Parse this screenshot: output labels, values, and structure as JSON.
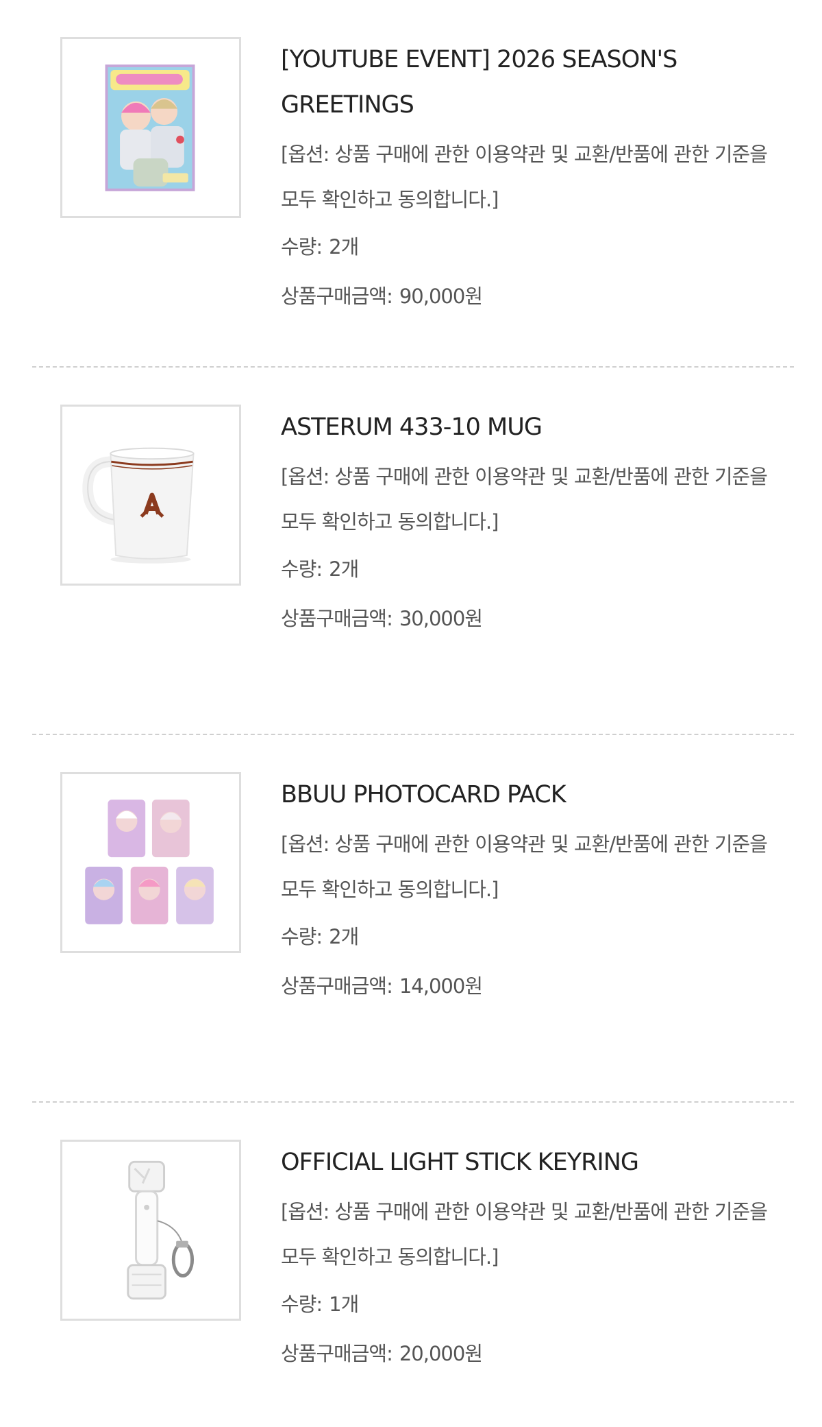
{
  "order_items": [
    {
      "image_icon": "season-greetings-calendar",
      "name": "[YOUTUBE EVENT] 2026 SEASON'S GREETINGS",
      "option": "[옵션: 상품 구매에 관한 이용약관 및 교환/반품에 관한 기준을 모두 확인하고 동의합니다.]",
      "qty_label": "수량:",
      "qty_value": "2개",
      "price_label": "상품구매금액:",
      "price_value": "90,000원"
    },
    {
      "image_icon": "white-mug",
      "name": "ASTERUM 433-10 MUG",
      "option": "[옵션: 상품 구매에 관한 이용약관 및 교환/반품에 관한 기준을 모두 확인하고 동의합니다.]",
      "qty_label": "수량:",
      "qty_value": "2개",
      "price_label": "상품구매금액:",
      "price_value": "30,000원"
    },
    {
      "image_icon": "photocard-set",
      "name": "BBUU PHOTOCARD PACK",
      "option": "[옵션: 상품 구매에 관한 이용약관 및 교환/반품에 관한 기준을 모두 확인하고 동의합니다.]",
      "qty_label": "수량:",
      "qty_value": "2개",
      "price_label": "상품구매금액:",
      "price_value": "14,000원"
    },
    {
      "image_icon": "light-stick-keyring",
      "name": "OFFICIAL LIGHT STICK KEYRING",
      "option": "[옵션: 상품 구매에 관한 이용약관 및 교환/반품에 관한 기준을 모두 확인하고 동의합니다.]",
      "qty_label": "수량:",
      "qty_value": "1개",
      "price_label": "상품구매금액:",
      "price_value": "20,000원"
    }
  ],
  "colors": {
    "text_primary": "#222222",
    "text_secondary": "#555555",
    "thumb_border": "#dedede",
    "divider": "#cfcfcf",
    "mug_accent": "#8b3a1e"
  }
}
